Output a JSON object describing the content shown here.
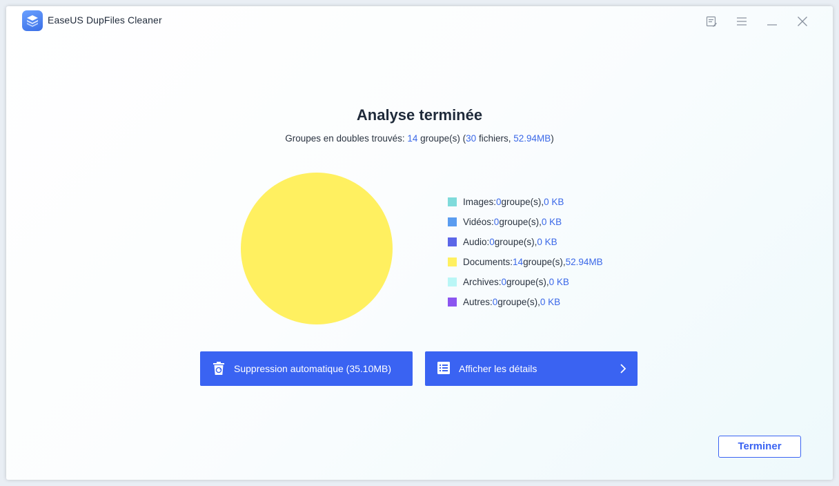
{
  "app": {
    "title": "EaseUS DupFiles Cleaner"
  },
  "window_controls": {
    "feedback_icon": "feedback-icon",
    "menu_icon": "menu-icon",
    "minimize_icon": "minimize-icon",
    "close_icon": "close-icon"
  },
  "main": {
    "title": "Analyse terminée",
    "summary": {
      "prefix": "Groupes en doubles trouvés: ",
      "groups": "14",
      "groups_unit": " groupe(s) (",
      "files": "30",
      "files_unit": " fichiers, ",
      "size": "52.94MB",
      "suffix": ")"
    }
  },
  "colors": {
    "accent": "#3a63f2",
    "value_blue": "#3a68e8",
    "images": "#7fdbdb",
    "videos": "#5a9cf0",
    "audio": "#5b66e8",
    "documents": "#fff060",
    "archives": "#b9f6f6",
    "autres": "#8b55f0"
  },
  "chart_data": {
    "type": "pie",
    "categories": [
      "Images",
      "Vidéos",
      "Audio",
      "Documents",
      "Archives",
      "Autres"
    ],
    "values": [
      0,
      0,
      0,
      52.94,
      0,
      0
    ],
    "colors": [
      "#7fdbdb",
      "#5a9cf0",
      "#5b66e8",
      "#fff060",
      "#b9f6f6",
      "#8b55f0"
    ]
  },
  "legend": [
    {
      "key": "images",
      "label": "Images: ",
      "groups": "0",
      "groups_unit": " groupe(s), ",
      "size": "0 KB",
      "color": "#7fdbdb"
    },
    {
      "key": "videos",
      "label": "Vidéos: ",
      "groups": "0",
      "groups_unit": " groupe(s), ",
      "size": "0 KB",
      "color": "#5a9cf0"
    },
    {
      "key": "audio",
      "label": "Audio: ",
      "groups": "0",
      "groups_unit": " groupe(s), ",
      "size": "0 KB",
      "color": "#5b66e8"
    },
    {
      "key": "documents",
      "label": "Documents: ",
      "groups": "14",
      "groups_unit": " groupe(s), ",
      "size": "52.94MB",
      "color": "#fff060"
    },
    {
      "key": "archives",
      "label": "Archives: ",
      "groups": "0",
      "groups_unit": " groupe(s), ",
      "size": "0 KB",
      "color": "#b9f6f6"
    },
    {
      "key": "autres",
      "label": "Autres: ",
      "groups": "0",
      "groups_unit": " groupe(s), ",
      "size": "0 KB",
      "color": "#8b55f0"
    }
  ],
  "actions": {
    "auto_delete_label": "Suppression automatique (35.10MB)",
    "auto_delete_icon": "recycle-bin-icon",
    "details_label": "Afficher les détails",
    "details_icon": "list-icon",
    "details_arrow_icon": "chevron-right-icon",
    "finish_label": "Terminer"
  }
}
